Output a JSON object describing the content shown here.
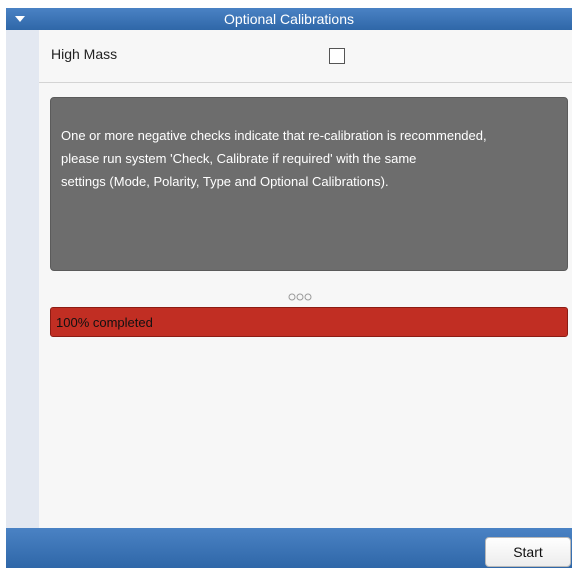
{
  "panel": {
    "title": "Optional Calibrations",
    "collapse_icon": "triangle-down-icon"
  },
  "options": [
    {
      "label": "High Mass",
      "checked": false
    }
  ],
  "message": {
    "lines": [
      "One or more negative checks indicate that re-calibration is recommended,",
      "please run system 'Check, Calibrate if required' with the same",
      "settings (Mode, Polarity, Type and Optional Calibrations)."
    ]
  },
  "splitter": {
    "icon": "drag-grip-icon"
  },
  "progress": {
    "value": 1.0,
    "label": "100% completed",
    "color": "#c12e23"
  },
  "footer": {
    "start_label": "Start"
  },
  "colors": {
    "header_blue": "#3a73b6",
    "message_background": "#6d6d6d",
    "left_rail": "#e3e8f1"
  }
}
